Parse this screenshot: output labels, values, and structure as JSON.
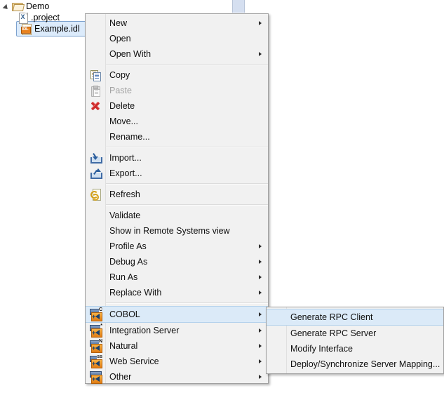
{
  "tree": {
    "nodes": [
      {
        "label": "Demo",
        "icon": "folder-icon",
        "expanded": true,
        "selected": false
      },
      {
        "label": ".project",
        "icon": "xml-file-icon",
        "selected": false
      },
      {
        "label": "Example.idl",
        "icon": "idl-file-icon",
        "selected": true,
        "icon_text": "IDL"
      }
    ]
  },
  "context_menu": {
    "items": [
      {
        "label": "New",
        "icon": null,
        "submenu": true,
        "enabled": true
      },
      {
        "label": "Open",
        "icon": null,
        "submenu": false,
        "enabled": true
      },
      {
        "label": "Open With",
        "icon": null,
        "submenu": true,
        "enabled": true
      },
      {
        "separator": true
      },
      {
        "label": "Copy",
        "icon": "copy-icon",
        "submenu": false,
        "enabled": true
      },
      {
        "label": "Paste",
        "icon": "paste-icon",
        "submenu": false,
        "enabled": false
      },
      {
        "label": "Delete",
        "icon": "delete-icon",
        "submenu": false,
        "enabled": true
      },
      {
        "label": "Move...",
        "icon": null,
        "submenu": false,
        "enabled": true
      },
      {
        "label": "Rename...",
        "icon": null,
        "submenu": false,
        "enabled": true
      },
      {
        "separator": true
      },
      {
        "label": "Import...",
        "icon": "import-icon",
        "submenu": false,
        "enabled": true
      },
      {
        "label": "Export...",
        "icon": "export-icon",
        "submenu": false,
        "enabled": true
      },
      {
        "separator": true
      },
      {
        "label": "Refresh",
        "icon": "refresh-icon",
        "submenu": false,
        "enabled": true
      },
      {
        "separator": true
      },
      {
        "label": "Validate",
        "icon": null,
        "submenu": false,
        "enabled": true
      },
      {
        "label": "Show in Remote Systems view",
        "icon": null,
        "submenu": false,
        "enabled": true
      },
      {
        "label": "Profile As",
        "icon": null,
        "submenu": true,
        "enabled": true
      },
      {
        "label": "Debug As",
        "icon": null,
        "submenu": true,
        "enabled": true
      },
      {
        "label": "Run As",
        "icon": null,
        "submenu": true,
        "enabled": true
      },
      {
        "label": "Replace With",
        "icon": null,
        "submenu": true,
        "enabled": true
      },
      {
        "separator": true
      },
      {
        "label": "COBOL",
        "icon": "cobol-service-icon",
        "icon_letter": "C",
        "submenu": true,
        "enabled": true,
        "highlighted": true
      },
      {
        "label": "Integration Server",
        "icon": "integration-server-icon",
        "icon_letter": "*",
        "submenu": true,
        "enabled": true
      },
      {
        "label": "Natural",
        "icon": "natural-service-icon",
        "icon_letter": "N",
        "submenu": true,
        "enabled": true
      },
      {
        "label": "Web Service",
        "icon": "web-service-icon",
        "icon_letter": "ss",
        "submenu": true,
        "enabled": true
      },
      {
        "label": "Other",
        "icon": "other-service-icon",
        "icon_letter": "",
        "submenu": true,
        "enabled": true
      }
    ]
  },
  "submenu": {
    "parent": "COBOL",
    "items": [
      {
        "label": "Generate RPC Client",
        "highlighted": true,
        "enabled": true
      },
      {
        "label": "Generate RPC Server",
        "highlighted": false,
        "enabled": true
      },
      {
        "label": "Modify Interface",
        "highlighted": false,
        "enabled": true
      },
      {
        "label": "Deploy/Synchronize Server Mapping...",
        "highlighted": false,
        "enabled": true
      }
    ]
  },
  "colors": {
    "menu_background": "#f1f1f1",
    "menu_border": "#a0a0a0",
    "highlight_fill": "#dbeaf8",
    "highlight_border": "#b5d2ec",
    "selection_fill": "#dcebfb",
    "selection_border": "#7da2ce",
    "disabled_text": "#a3a3a3",
    "accent_orange": "#e07c14"
  }
}
